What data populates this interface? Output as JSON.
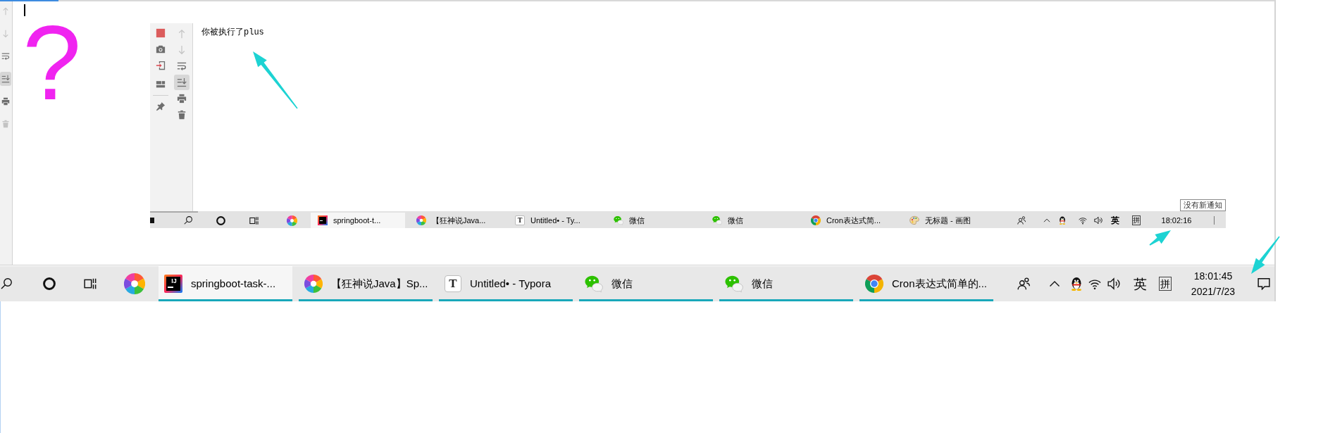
{
  "editor": {
    "side_tools": [
      {
        "disabled": true,
        "on": false
      },
      {
        "disabled": true,
        "on": false
      },
      {
        "disabled": false,
        "on": false
      },
      {
        "disabled": false,
        "on": true
      },
      {
        "disabled": false,
        "on": false
      },
      {
        "disabled": true,
        "on": false
      }
    ]
  },
  "annotation": {
    "question_mark": "?"
  },
  "screenshot": {
    "right_tools": [
      {
        "disabled": true,
        "on": false
      },
      {
        "disabled": true,
        "on": false
      },
      {
        "disabled": false,
        "on": false
      },
      {
        "disabled": false,
        "on": true
      },
      {
        "disabled": false,
        "on": false
      },
      {
        "disabled": false,
        "on": false
      }
    ],
    "output": "你被执行了plus",
    "tooltip": "没有新通知",
    "taskbar": {
      "apps": [
        {
          "kind": "browser",
          "selected": false
        },
        {
          "kind": "ide",
          "label": "springboot-t...",
          "selected": true
        },
        {
          "kind": "browser",
          "label": "【狂神说Java...",
          "selected": false
        },
        {
          "kind": "writer",
          "logo_text": "T",
          "label": "Untitled• - Ty...",
          "selected": false
        },
        {
          "kind": "chat",
          "label": "微信",
          "selected": false
        },
        {
          "kind": "chat",
          "label": "微信",
          "selected": false
        },
        {
          "kind": "web",
          "label": "Cron表达式简...",
          "selected": false
        },
        {
          "kind": "paint",
          "label": "无标题 - 画图",
          "selected": false
        }
      ],
      "tray": {
        "language": "英",
        "ime": "拼",
        "time": "18:02:16"
      }
    }
  },
  "taskbar": {
    "apps": [
      {
        "kind": "browser",
        "selected": false
      },
      {
        "kind": "ide",
        "logo_text": "IJ",
        "label": "springboot-task-...",
        "selected": true
      },
      {
        "kind": "browser",
        "label": "【狂神说Java】Sp...",
        "selected": false
      },
      {
        "kind": "writer",
        "logo_text": "T",
        "label": "Untitled• - Typora",
        "selected": false
      },
      {
        "kind": "chat",
        "label": "微信",
        "selected": false
      },
      {
        "kind": "chat",
        "label": "微信",
        "selected": false
      },
      {
        "kind": "web",
        "label": "Cron表达式简单的...",
        "selected": false
      }
    ],
    "tray": {
      "language": "英",
      "ime": "拼",
      "time": "18:01:45",
      "date": "2021/7/23"
    }
  }
}
